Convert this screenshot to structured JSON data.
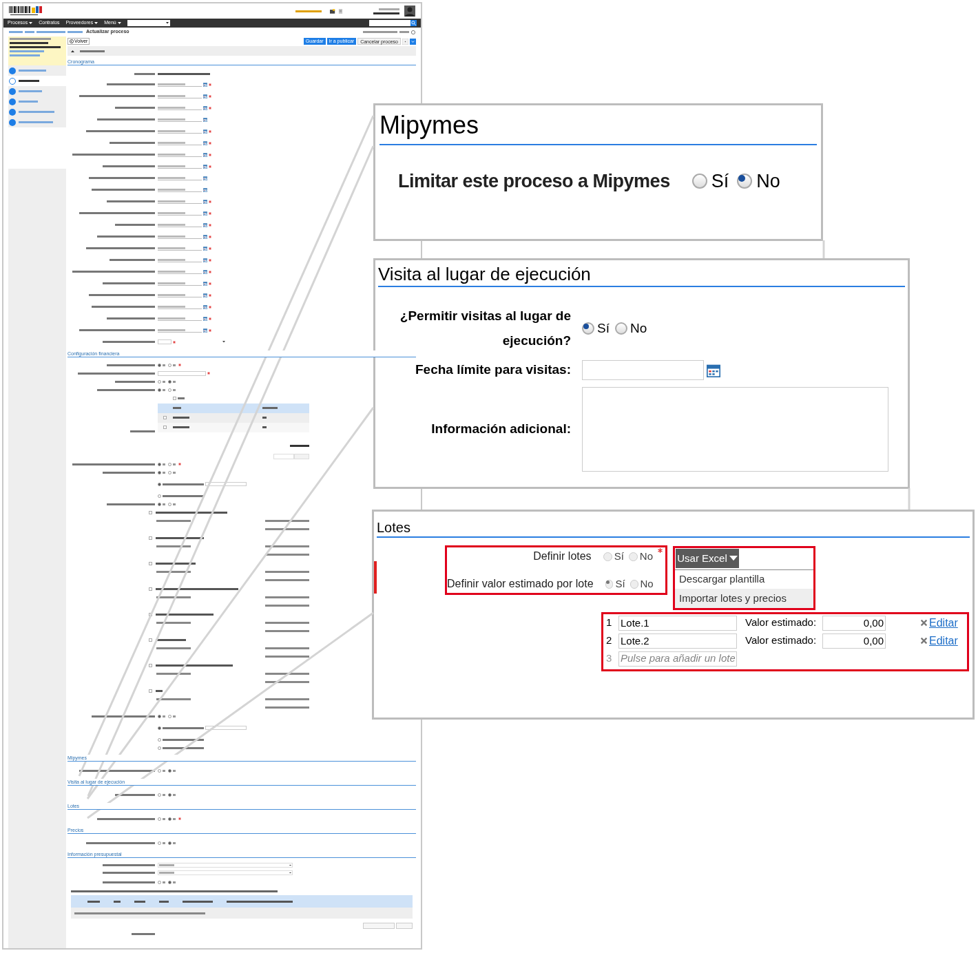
{
  "mini": {
    "nav_menus": [
      {
        "label": "Procesos",
        "dropdown": true
      },
      {
        "label": "Contratos",
        "dropdown": false
      },
      {
        "label": "Proveedores",
        "dropdown": true
      },
      {
        "label": "Menú",
        "dropdown": true
      }
    ],
    "page_title": "Actualizar proceso",
    "toolbar": {
      "back": "Volver",
      "buttons": [
        {
          "label": "Guardar",
          "kind": "primary"
        },
        {
          "label": "Ir a publicar",
          "kind": "primary"
        },
        {
          "label": "Cancelar proceso",
          "kind": "default"
        }
      ]
    },
    "steps": [
      {
        "selected": false
      },
      {
        "selected": true
      },
      {
        "selected": false
      },
      {
        "selected": false
      },
      {
        "selected": false
      },
      {
        "selected": false
      }
    ],
    "sections": [
      {
        "title": "Cronograma",
        "rows": [
          {
            "kind": "text"
          },
          {
            "kind": "date",
            "required": true
          },
          {
            "kind": "date",
            "required": true
          },
          {
            "kind": "date",
            "required": true
          },
          {
            "kind": "date",
            "required": false
          },
          {
            "kind": "date",
            "required": true
          },
          {
            "kind": "date",
            "required": true
          },
          {
            "kind": "date",
            "required": true
          },
          {
            "kind": "date",
            "required": true
          },
          {
            "kind": "date",
            "required": false
          },
          {
            "kind": "date",
            "required": false
          },
          {
            "kind": "date",
            "required": true
          },
          {
            "kind": "date",
            "required": true
          },
          {
            "kind": "date",
            "required": true
          },
          {
            "kind": "date",
            "required": true
          },
          {
            "kind": "date",
            "required": true
          },
          {
            "kind": "date",
            "required": true
          },
          {
            "kind": "date",
            "required": true
          },
          {
            "kind": "date",
            "required": true
          },
          {
            "kind": "date",
            "required": true
          },
          {
            "kind": "date",
            "required": true
          },
          {
            "kind": "date",
            "required": true
          },
          {
            "kind": "date",
            "required": true
          },
          {
            "kind": "number_unit",
            "required": true
          }
        ]
      },
      {
        "title": "Configuración financiera",
        "rows": [
          {
            "kind": "radio",
            "options": [
              {
                "selected": true
              },
              {
                "selected": false
              }
            ],
            "required": true
          },
          {
            "kind": "field",
            "required": true
          },
          {
            "kind": "radio",
            "options": [
              {
                "selected": false
              },
              {
                "selected": true
              }
            ],
            "required": false
          },
          {
            "kind": "radio",
            "options": [
              {
                "selected": true
              },
              {
                "selected": false
              }
            ],
            "required": false
          },
          {
            "kind": "checkbox",
            "checked": false
          },
          {
            "kind": "table",
            "rows": [
              {
                "checked": false
              },
              {
                "checked": false
              }
            ]
          },
          {
            "kind": "radio",
            "options": [
              {
                "selected": true
              },
              {
                "selected": false
              }
            ],
            "required": true
          },
          {
            "kind": "radio",
            "options": [
              {
                "selected": true
              },
              {
                "selected": false
              }
            ],
            "required": false
          },
          {
            "kind": "choice",
            "selected": true,
            "field": true
          },
          {
            "kind": "choice",
            "selected": false,
            "field": false
          },
          {
            "kind": "radio",
            "options": [
              {
                "selected": true
              },
              {
                "selected": false
              }
            ],
            "required": false
          },
          {
            "kind": "coverage",
            "checked": false
          },
          {
            "kind": "coverage",
            "checked": false
          },
          {
            "kind": "coverage",
            "checked": false
          },
          {
            "kind": "coverage",
            "checked": false
          },
          {
            "kind": "coverage",
            "checked": false
          },
          {
            "kind": "coverage",
            "checked": false
          },
          {
            "kind": "coverage",
            "checked": false
          },
          {
            "kind": "coverage",
            "checked": false
          },
          {
            "kind": "radio",
            "options": [
              {
                "selected": true
              },
              {
                "selected": false
              }
            ],
            "required": false
          },
          {
            "kind": "choice",
            "selected": true,
            "field": true
          },
          {
            "kind": "choice",
            "selected": false,
            "field": false
          },
          {
            "kind": "choice",
            "selected": false,
            "field": false
          }
        ]
      },
      {
        "title": "Mipymes",
        "rows": [
          {
            "kind": "radio",
            "options": [
              {
                "selected": false
              },
              {
                "selected": true
              }
            ],
            "required": false
          }
        ]
      },
      {
        "title": "Visita al lugar de ejecución",
        "rows": [
          {
            "kind": "radio",
            "options": [
              {
                "selected": false
              },
              {
                "selected": true
              }
            ],
            "required": false
          }
        ]
      },
      {
        "title": "Lotes",
        "rows": [
          {
            "kind": "radio",
            "options": [
              {
                "selected": false
              },
              {
                "selected": true
              }
            ],
            "required": true
          }
        ]
      },
      {
        "title": "Precios",
        "rows": [
          {
            "kind": "radio",
            "options": [
              {
                "selected": false
              },
              {
                "selected": true
              }
            ],
            "required": false
          }
        ]
      },
      {
        "title": "Información presupuestal",
        "rows": [
          {
            "kind": "select"
          },
          {
            "kind": "select"
          },
          {
            "kind": "radio",
            "options": [
              {
                "selected": false
              },
              {
                "selected": true
              }
            ],
            "required": false
          },
          {
            "kind": "note"
          },
          {
            "kind": "grid"
          },
          {
            "kind": "buttons"
          },
          {
            "kind": "label"
          }
        ]
      }
    ]
  },
  "zoom_mipymes": {
    "title": "Mipymes",
    "label": "Limitar este proceso a Mipymes",
    "options": [
      {
        "label": "Sí",
        "selected": false
      },
      {
        "label": "No",
        "selected": true
      }
    ]
  },
  "zoom_visit": {
    "title": "Visita al lugar de ejecución",
    "label": "¿Permitir visitas al lugar de ejecución?",
    "options": [
      {
        "label": "Sí",
        "selected": true
      },
      {
        "label": "No",
        "selected": false
      }
    ],
    "deadline_label": "Fecha límite para visitas:",
    "info_label": "Información adicional:"
  },
  "zoom_lots": {
    "title": "Lotes",
    "rows": [
      {
        "label": "Definir lotes",
        "options": [
          {
            "label": "Sí",
            "selected": false
          },
          {
            "label": "No",
            "selected": false
          }
        ],
        "required": true
      },
      {
        "label": "Definir valor estimado por lote",
        "options": [
          {
            "label": "Sí",
            "selected": true
          },
          {
            "label": "No",
            "selected": false
          }
        ],
        "required": false
      }
    ],
    "excel": {
      "label": "Usar Excel",
      "items": [
        {
          "label": "Descargar plantilla",
          "selected": false
        },
        {
          "label": "Importar lotes y precios",
          "selected": true
        }
      ]
    },
    "lots": [
      {
        "number": "1",
        "name": "Lote.1",
        "value_label": "Valor estimado:",
        "value": "0,00",
        "edit": "Editar"
      },
      {
        "number": "2",
        "name": "Lote.2",
        "value_label": "Valor estimado:",
        "value": "0,00",
        "edit": "Editar"
      }
    ],
    "new_lot": {
      "number": "3",
      "placeholder": "Pulse para añadir un lote"
    }
  }
}
